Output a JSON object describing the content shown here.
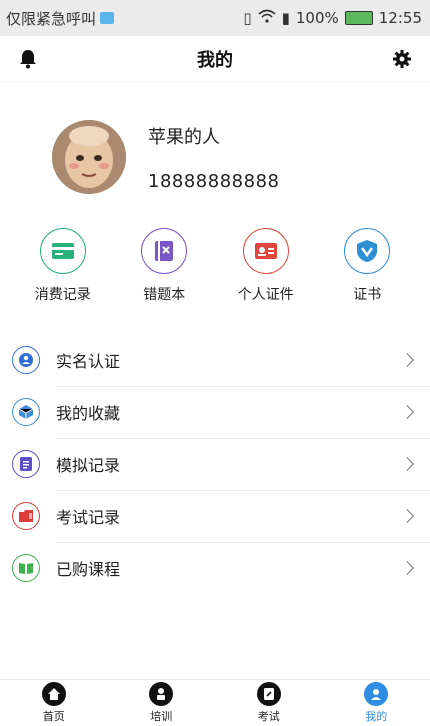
{
  "status_bar": {
    "carrier_text": "仅限紧急呼叫",
    "battery": "100%",
    "time": "12:55"
  },
  "header": {
    "title": "我的"
  },
  "profile": {
    "name": "苹果的人",
    "phone": "18888888888"
  },
  "quick_actions": [
    {
      "label": "消费记录",
      "icon": "card-icon",
      "color": "#27b07a"
    },
    {
      "label": "错题本",
      "icon": "book-x-icon",
      "color": "#7a56c6"
    },
    {
      "label": "个人证件",
      "icon": "id-card-icon",
      "color": "#e0463e"
    },
    {
      "label": "证书",
      "icon": "shield-check-icon",
      "color": "#2d8fd6"
    }
  ],
  "menu": [
    {
      "label": "实名认证",
      "icon": "user-id-icon",
      "color": "#2f6fd8"
    },
    {
      "label": "我的收藏",
      "icon": "cube-icon",
      "color": "#3a8fe0"
    },
    {
      "label": "模拟记录",
      "icon": "document-icon",
      "color": "#5a4fc8"
    },
    {
      "label": "考试记录",
      "icon": "folder-icon",
      "color": "#e03c3c"
    },
    {
      "label": "已购课程",
      "icon": "open-book-icon",
      "color": "#3cb34a"
    }
  ],
  "tabbar": [
    {
      "label": "首页",
      "icon": "home-icon",
      "active": false
    },
    {
      "label": "培训",
      "icon": "training-icon",
      "active": false
    },
    {
      "label": "考试",
      "icon": "exam-icon",
      "active": false
    },
    {
      "label": "我的",
      "icon": "user-icon",
      "active": true
    }
  ],
  "colors": {
    "accent": "#2f8de4",
    "dark": "#111111"
  }
}
